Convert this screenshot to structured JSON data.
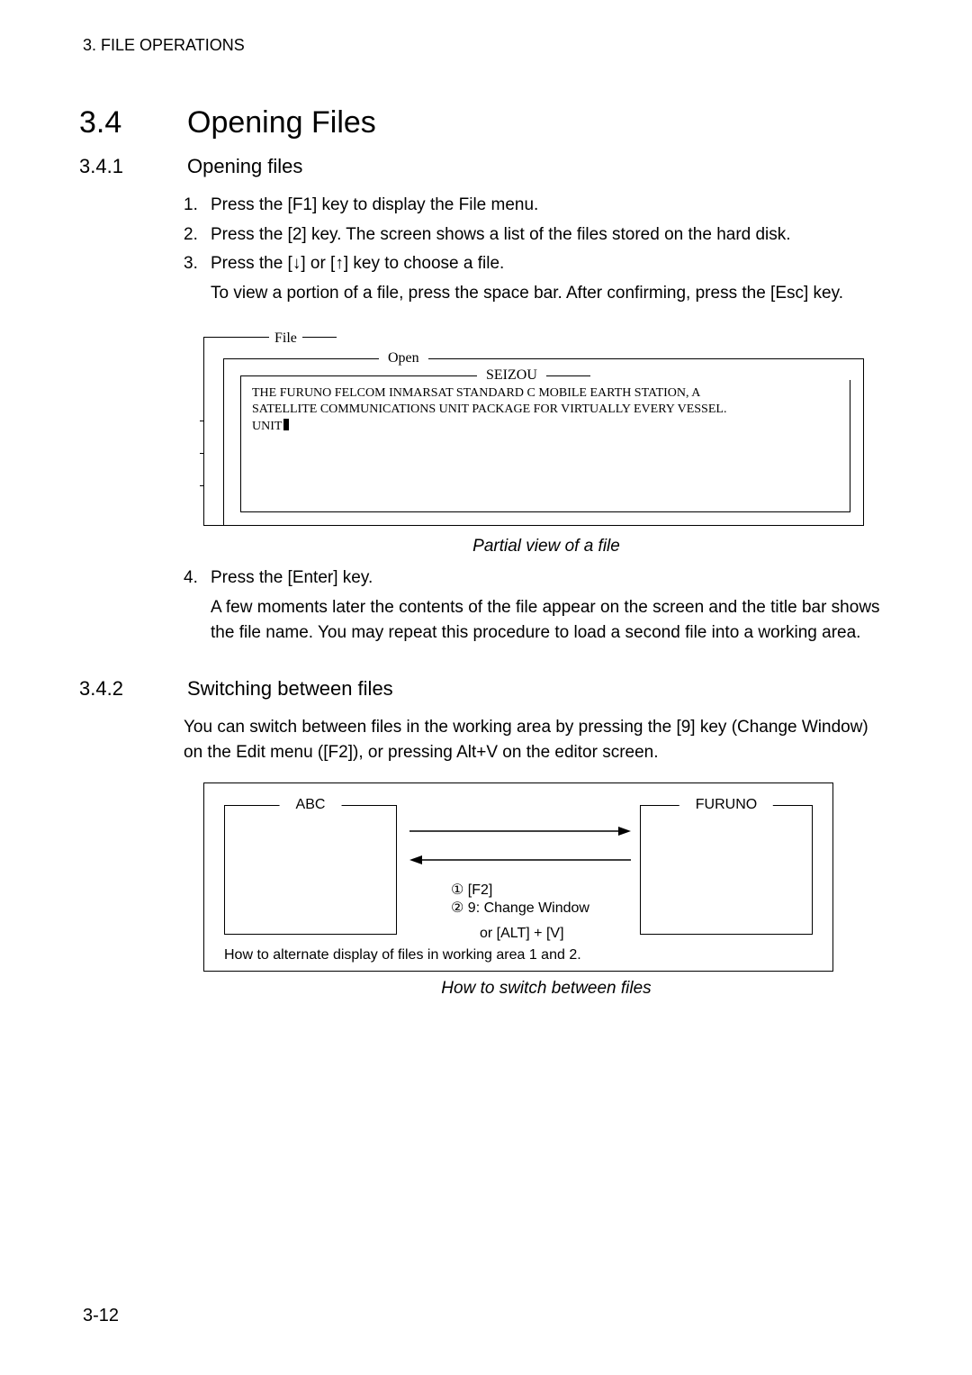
{
  "header": "3. FILE OPERATIONS",
  "section": {
    "number": "3.4",
    "title": "Opening Files"
  },
  "subsection_341": {
    "number": "3.4.1",
    "title": "Opening files",
    "steps": [
      "Press the [F1] key to display the File menu.",
      "Press the [2] key. The screen shows a list of the files stored on the hard disk.",
      "Press the [↓] or [↑] key to choose a file."
    ],
    "step3_sub": "To view a portion of a file, press the space bar. After confirming, press the [Esc] key.",
    "figure1": {
      "file_label": "File",
      "open_label": "Open",
      "seizou_label": "SEIZOU",
      "inner_text_line1": "THE FURUNO FELCOM INMARSAT STANDARD C MOBILE EARTH STATION, A",
      "inner_text_line2": "SATELLITE COMMUNICATIONS UNIT PACKAGE FOR VIRTUALLY EVERY VESSEL.",
      "inner_text_line3": "UNIT",
      "caption": "Partial view of a file"
    },
    "step4": "Press the [Enter] key.",
    "step4_sub": "A few moments later the contents of the file appear on the screen and the title bar shows the file name. You may repeat this procedure to load a second file into a working area."
  },
  "subsection_342": {
    "number": "3.4.2",
    "title": "Switching between files",
    "para": "You can switch between files in the working area by pressing the [9] key (Change Window) on the Edit menu ([F2]), or pressing Alt+V on the editor screen.",
    "figure2": {
      "abc_label": "ABC",
      "furuno_label": "FURUNO",
      "line1": "① [F2]",
      "line2": "② 9: Change Window",
      "line3": "or [ALT] + [V]",
      "bottom": "How to alternate display of files in working area 1 and 2.",
      "caption": "How to switch between files"
    }
  },
  "page_number": "3-12"
}
